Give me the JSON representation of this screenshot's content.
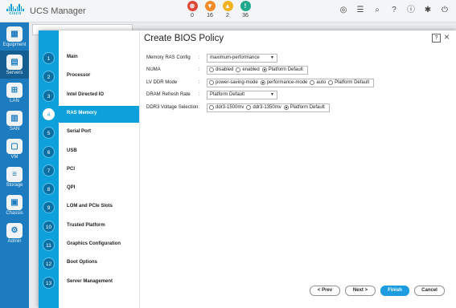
{
  "app": {
    "title": "UCS Manager",
    "logo_text": "cisco"
  },
  "faults": [
    {
      "icon": "critical-fault-icon",
      "symbol": "⊗",
      "count": "0",
      "color": "#e0473a"
    },
    {
      "icon": "major-fault-icon",
      "symbol": "▼",
      "count": "16",
      "color": "#f28b2a"
    },
    {
      "icon": "minor-fault-icon",
      "symbol": "▲",
      "count": "2",
      "color": "#f2b321"
    },
    {
      "icon": "warning-fault-icon",
      "symbol": "!",
      "count": "36",
      "color": "#21a88c"
    }
  ],
  "toolbar_icons": [
    {
      "name": "pending-activities-icon",
      "symbol": "◎"
    },
    {
      "name": "nav-icon",
      "symbol": "☰"
    },
    {
      "name": "search-icon",
      "symbol": "⌕"
    },
    {
      "name": "help-icon",
      "symbol": "?"
    },
    {
      "name": "info-icon",
      "symbol": "ⓘ"
    },
    {
      "name": "settings-icon",
      "symbol": "✱"
    },
    {
      "name": "logout-icon",
      "symbol": "⏻"
    }
  ],
  "nav": [
    {
      "label": "Equipment",
      "icon": "equipment-icon",
      "symbol": "▦"
    },
    {
      "label": "Servers",
      "icon": "servers-icon",
      "symbol": "▤"
    },
    {
      "label": "LAN",
      "icon": "lan-icon",
      "symbol": "⊞"
    },
    {
      "label": "SAN",
      "icon": "san-icon",
      "symbol": "▥"
    },
    {
      "label": "VM",
      "icon": "vm-icon",
      "symbol": "▢"
    },
    {
      "label": "Storage",
      "icon": "storage-icon",
      "symbol": "≡"
    },
    {
      "label": "Chassis",
      "icon": "chassis-icon",
      "symbol": "▣"
    },
    {
      "label": "Admin",
      "icon": "admin-icon",
      "symbol": "⚙"
    }
  ],
  "dialog": {
    "title": "Create BIOS Policy",
    "help": "?",
    "close": "×",
    "steps": [
      {
        "num": "1",
        "label": "Main"
      },
      {
        "num": "2",
        "label": "Processor"
      },
      {
        "num": "3",
        "label": "Intel Directed IO"
      },
      {
        "num": "4",
        "label": "RAS Memory"
      },
      {
        "num": "5",
        "label": "Serial Port"
      },
      {
        "num": "6",
        "label": "USB"
      },
      {
        "num": "7",
        "label": "PCI"
      },
      {
        "num": "8",
        "label": "QPI"
      },
      {
        "num": "9",
        "label": "LOM and PCIe Slots"
      },
      {
        "num": "10",
        "label": "Trusted Platform"
      },
      {
        "num": "11",
        "label": "Graphics Configuration"
      },
      {
        "num": "12",
        "label": "Boot Options"
      },
      {
        "num": "13",
        "label": "Server Management"
      }
    ],
    "active_step": "4",
    "fields": {
      "memory_ras_config": {
        "label": "Memory RAS Config",
        "value": "maximum-performance"
      },
      "numa": {
        "label": "NUMA",
        "options": [
          "disabled",
          "enabled",
          "Platform Default"
        ],
        "selected": "Platform Default"
      },
      "lv_ddr_mode": {
        "label": "LV DDR Mode",
        "options": [
          "power-saving-mode",
          "performance-mode",
          "auto",
          "Platform Default"
        ],
        "selected": "performance-mode"
      },
      "dram_refresh_rate": {
        "label": "DRAM Refresh Rate",
        "value": "Platform Default"
      },
      "ddr3_voltage": {
        "label": "DDR3 Voltage Selection",
        "options": [
          "ddr3-1500mv",
          "ddr3-1350mv",
          "Platform Default"
        ],
        "selected": "Platform Default"
      }
    },
    "buttons": {
      "prev": "< Prev",
      "next": "Next >",
      "finish": "Finish",
      "cancel": "Cancel"
    }
  },
  "colors": {
    "accent": "#0ea0db",
    "sidebar": "#1d7cbf",
    "primary_button": "#1d9ce0"
  }
}
